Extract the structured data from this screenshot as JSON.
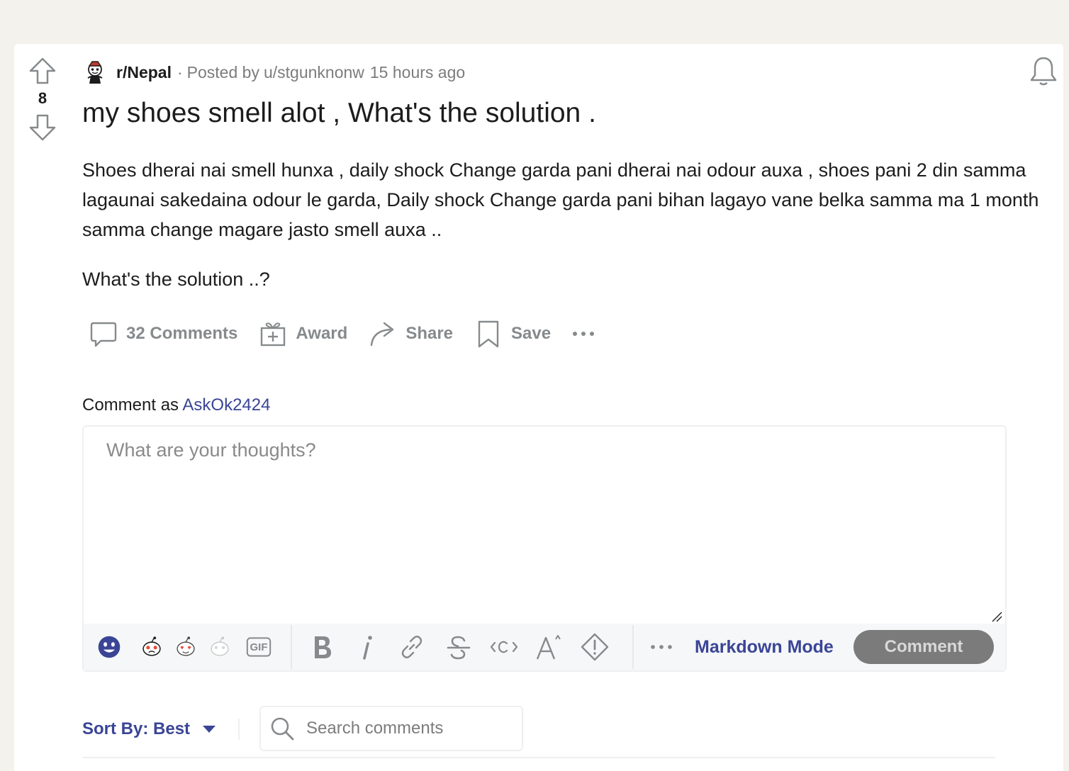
{
  "post": {
    "score": "8",
    "subreddit": "r/Nepal",
    "separator": "·",
    "posted_by": "Posted by",
    "author": "u/stgunknonw",
    "time": "15 hours ago",
    "title": "my shoes smell alot , What's the solution .",
    "body": [
      "Shoes dherai nai smell hunxa , daily shock Change garda pani dherai nai odour auxa , shoes pani 2 din samma lagaunai sakedaina odour le garda, Daily shock Change garda pani bihan lagayo vane belka samma ma 1 month samma change magare jasto smell auxa ..",
      "What's the solution ..?"
    ]
  },
  "actions": {
    "comments_label": "32 Comments",
    "award_label": "Award",
    "share_label": "Share",
    "save_label": "Save"
  },
  "composer": {
    "comment_as_label": "Comment as",
    "username": "AskOk2424",
    "placeholder": "What are your thoughts?",
    "markdown_mode_label": "Markdown Mode",
    "comment_button_label": "Comment",
    "gif_label": "GIF"
  },
  "sort": {
    "label": "Sort By: Best"
  },
  "search": {
    "placeholder": "Search comments"
  },
  "icons": {
    "vote": [
      "upvote-icon",
      "downvote-icon"
    ],
    "header": [
      "subreddit-avatar-icon",
      "bell-icon"
    ],
    "actions": [
      "comment-icon",
      "award-icon",
      "share-icon",
      "save-icon",
      "more-icon"
    ],
    "toolbar": [
      "emoji-icon",
      "snoo-emoji-icons",
      "gif-icon",
      "bold-icon",
      "italic-icon",
      "link-icon",
      "strikethrough-icon",
      "inline-code-icon",
      "superscript-icon",
      "spoiler-icon",
      "more-icon"
    ],
    "sort": [
      "caret-down-icon",
      "search-icon"
    ]
  },
  "colors": {
    "page_bg": "#f3f2ec",
    "card_bg": "#ffffff",
    "accent_link": "#3a4596",
    "muted": "#878a8c",
    "comment_button_bg": "#7b7b7b",
    "emoji_active": "#3a4596"
  }
}
